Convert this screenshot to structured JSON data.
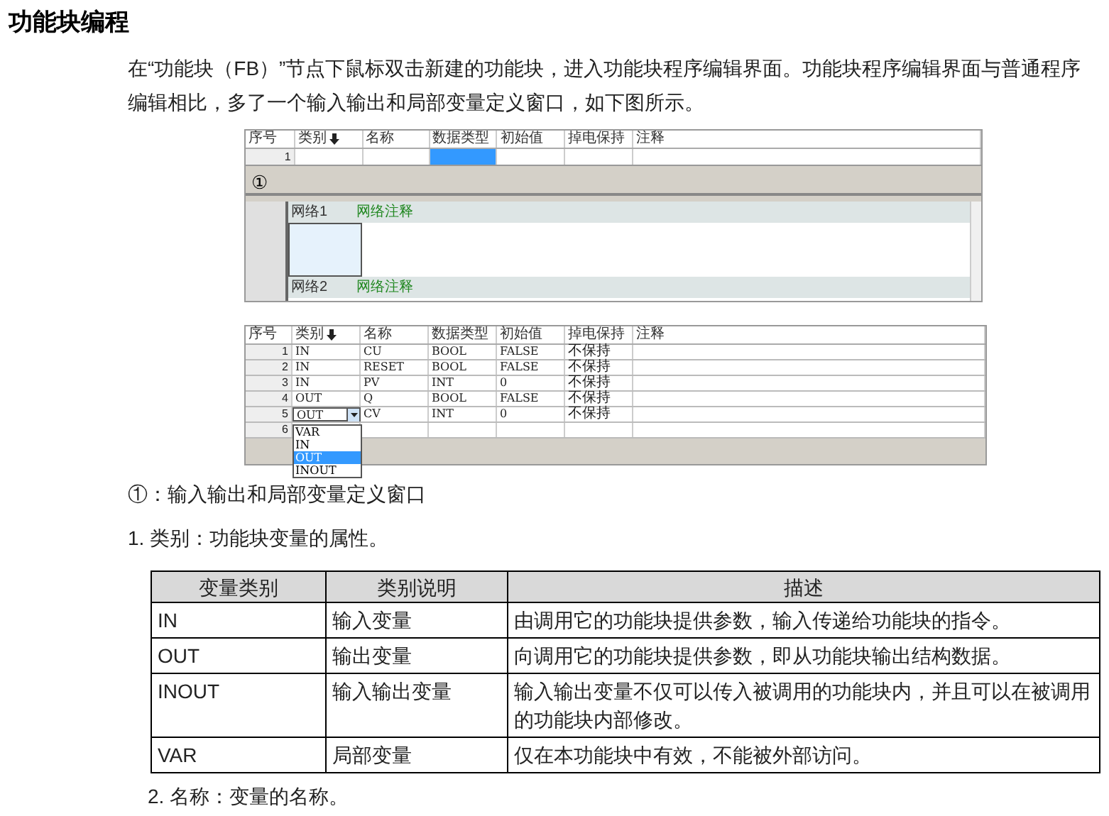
{
  "heading": "功能块编程",
  "intro": "在“功能块（FB）”节点下鼠标双击新建的功能块，进入功能块程序编辑界面。功能块程序编辑界面与普通程序编辑相比，多了一个输入输出和局部变量定义窗口，如下图所示。",
  "screenshot_1": {
    "columns": [
      "序号",
      "类别",
      "名称",
      "数据类型",
      "初始值",
      "掉电保持",
      "注释"
    ],
    "rows": [
      {
        "index": "1",
        "cells": [
          {
            "selected": false
          },
          {
            "selected": false
          },
          {
            "selected": true
          },
          {
            "selected": false
          },
          {
            "selected": false
          },
          {
            "selected": false
          }
        ]
      }
    ],
    "marker": "①",
    "networks": [
      {
        "label": "网络1",
        "comment": "网络注释"
      },
      {
        "label": "网络2",
        "comment": "网络注释"
      }
    ]
  },
  "screenshot_2": {
    "columns": [
      "序号",
      "类别",
      "名称",
      "数据类型",
      "初始值",
      "掉电保持",
      "注释"
    ],
    "rows": [
      {
        "cells": [
          "1",
          "IN",
          "CU",
          "BOOL",
          "FALSE",
          "不保持"
        ]
      },
      {
        "cells": [
          "2",
          "IN",
          "RESET",
          "BOOL",
          "FALSE",
          "不保持"
        ]
      },
      {
        "cells": [
          "3",
          "IN",
          "PV",
          "INT",
          "0",
          "不保持"
        ]
      },
      {
        "cells": [
          "4",
          "OUT",
          "Q",
          "BOOL",
          "FALSE",
          "不保持"
        ]
      },
      {
        "cells": [
          "5",
          "OUT",
          "CV",
          "INT",
          "0",
          "不保持"
        ],
        "dropdown": {
          "options": [
            {
              "label": "VAR",
              "selected": false
            },
            {
              "label": "IN",
              "selected": false
            },
            {
              "label": "OUT",
              "selected": true
            },
            {
              "label": "INOUT",
              "selected": false
            }
          ]
        }
      },
      {
        "cells": [
          "6"
        ]
      }
    ]
  },
  "caption": "①：输入输出和局部变量定义窗口",
  "item_1": "1. 类别：功能块变量的属性。",
  "table": {
    "columns": [
      "变量类别",
      "类别说明",
      "描述"
    ],
    "rows": [
      [
        "IN",
        "输入变量",
        "由调用它的功能块提供参数，输入传递给功能块的指令。"
      ],
      [
        "OUT",
        "输出变量",
        "向调用它的功能块提供参数，即从功能块输出结构数据。"
      ],
      [
        "INOUT",
        "输入输出变量",
        "输入输出变量不仅可以传入被调用的功能块内，并且可以在被调用的功能块内部修改。"
      ],
      [
        "VAR",
        "局部变量",
        "仅在本功能块中有效，不能被外部访问。"
      ]
    ]
  },
  "item_2": "2. 名称：变量的名称。"
}
